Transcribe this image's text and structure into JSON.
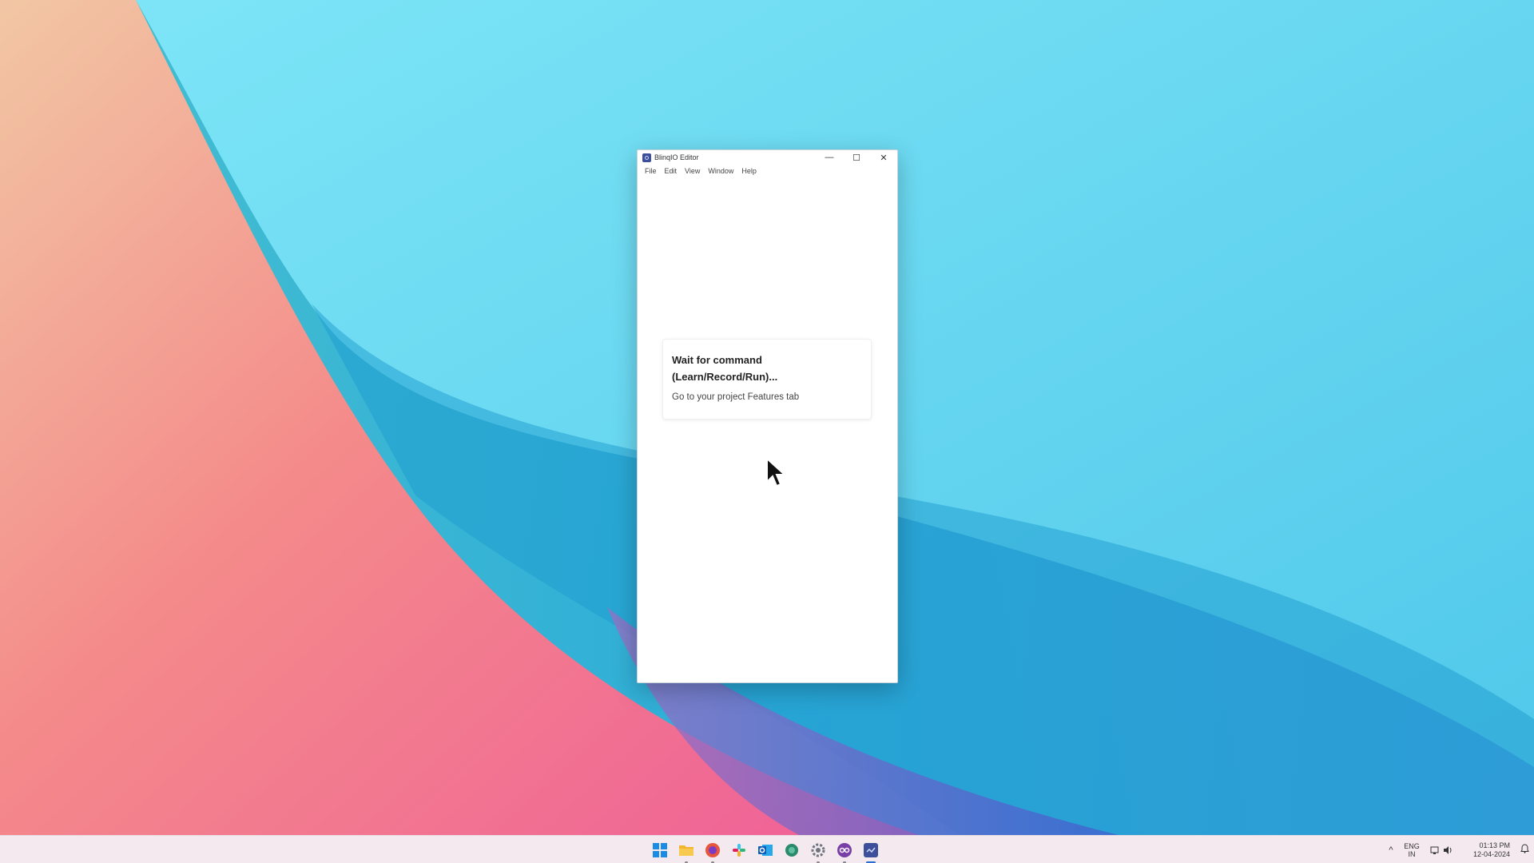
{
  "window": {
    "title": "BlinqIO Editor",
    "minimize_glyph": "—",
    "maximize_glyph": "☐",
    "close_glyph": "✕",
    "menu": [
      "File",
      "Edit",
      "View",
      "Window",
      "Help"
    ]
  },
  "card": {
    "title": "Wait for command (Learn/Record/Run)...",
    "subtitle": "Go to your project Features tab"
  },
  "taskbar": {
    "apps": [
      {
        "name": "start-icon",
        "color": "#1a8ce6"
      },
      {
        "name": "file-explorer-icon",
        "color": "#f2b530"
      },
      {
        "name": "firefox-icon",
        "color": "#e8553a"
      },
      {
        "name": "slack-icon",
        "color": "#c23d8e"
      },
      {
        "name": "outlook-icon",
        "color": "#1565c0"
      },
      {
        "name": "app-icon",
        "color": "#2b8a6b"
      },
      {
        "name": "settings-icon",
        "color": "#6e7580"
      },
      {
        "name": "blinq-icon",
        "color": "#7a3fa7"
      },
      {
        "name": "editor-icon",
        "color": "#3d4e9a"
      }
    ],
    "tray": {
      "chevron": "^",
      "lang_line1": "ENG",
      "lang_line2": "IN",
      "time": "01:13 PM",
      "date": "12-04-2024",
      "bell": "🔔"
    }
  }
}
